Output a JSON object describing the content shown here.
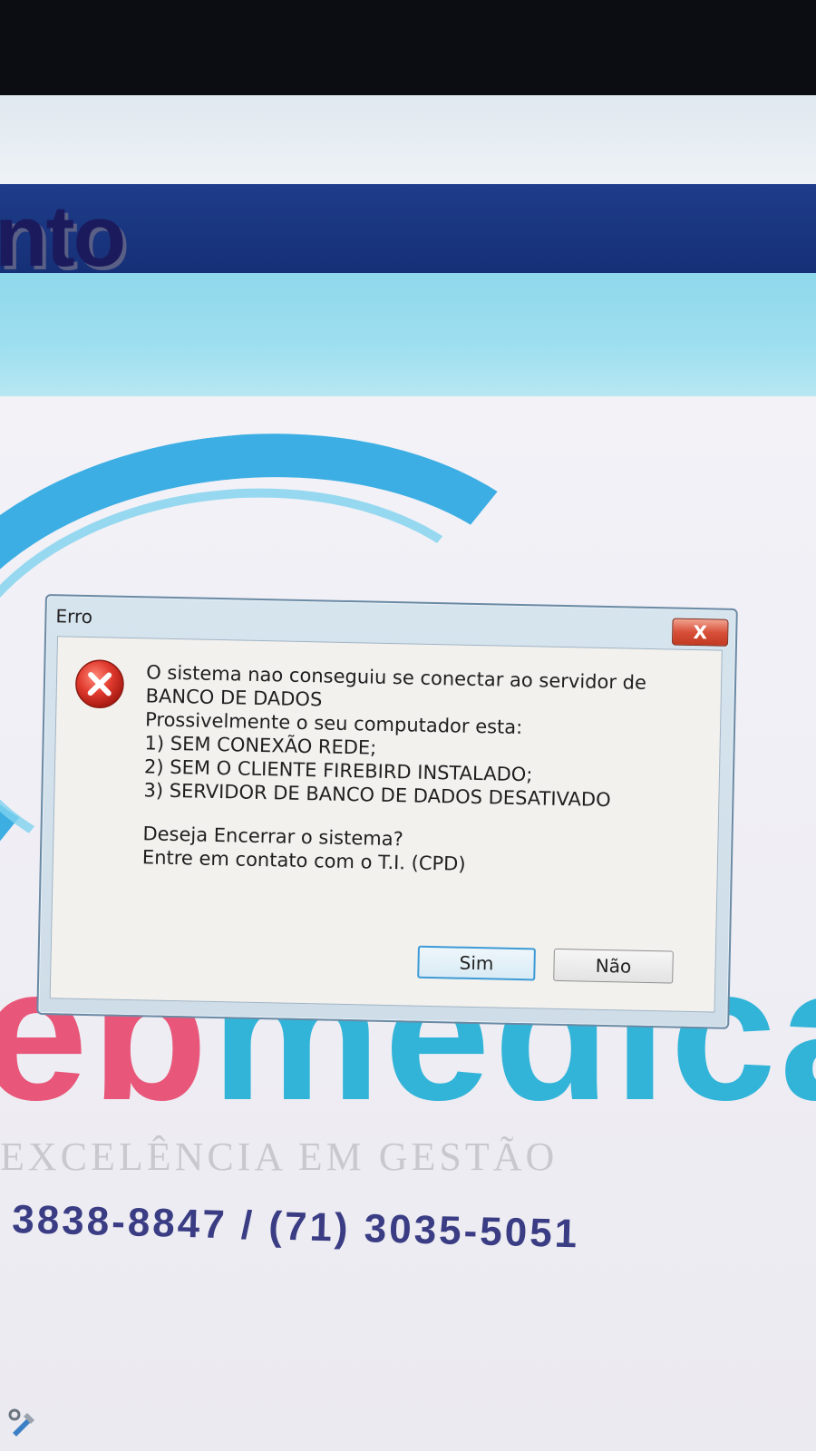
{
  "background_app": {
    "header_title": "nto",
    "logo": {
      "word_part_pink": "eb",
      "word_part_cyan": "medica",
      "tagline": "EXCELÊNCIA EM GESTÃO"
    },
    "phones": "3838-8847 / (71) 3035-5051"
  },
  "dialog": {
    "title": "Erro",
    "close_label": "X",
    "icon": "error-icon",
    "message_lines": [
      "O sistema nao conseguiu se conectar ao servidor de",
      "BANCO DE DADOS",
      "Prossivelmente o seu computador esta:",
      "1) SEM CONEXÃO REDE;",
      "2) SEM O CLIENTE FIREBIRD INSTALADO;",
      "3) SERVIDOR DE BANCO DE DADOS DESATIVADO"
    ],
    "question_lines": [
      "Deseja Encerrar o sistema?",
      "Entre em contato com o T.I. (CPD)"
    ],
    "buttons": {
      "yes": "Sim",
      "no": "Não"
    }
  },
  "colors": {
    "header_blue": "#163077",
    "header_cyan": "#9edff0",
    "logo_pink": "#e8577a",
    "logo_cyan": "#32b4d9",
    "error_red": "#d9302b"
  }
}
